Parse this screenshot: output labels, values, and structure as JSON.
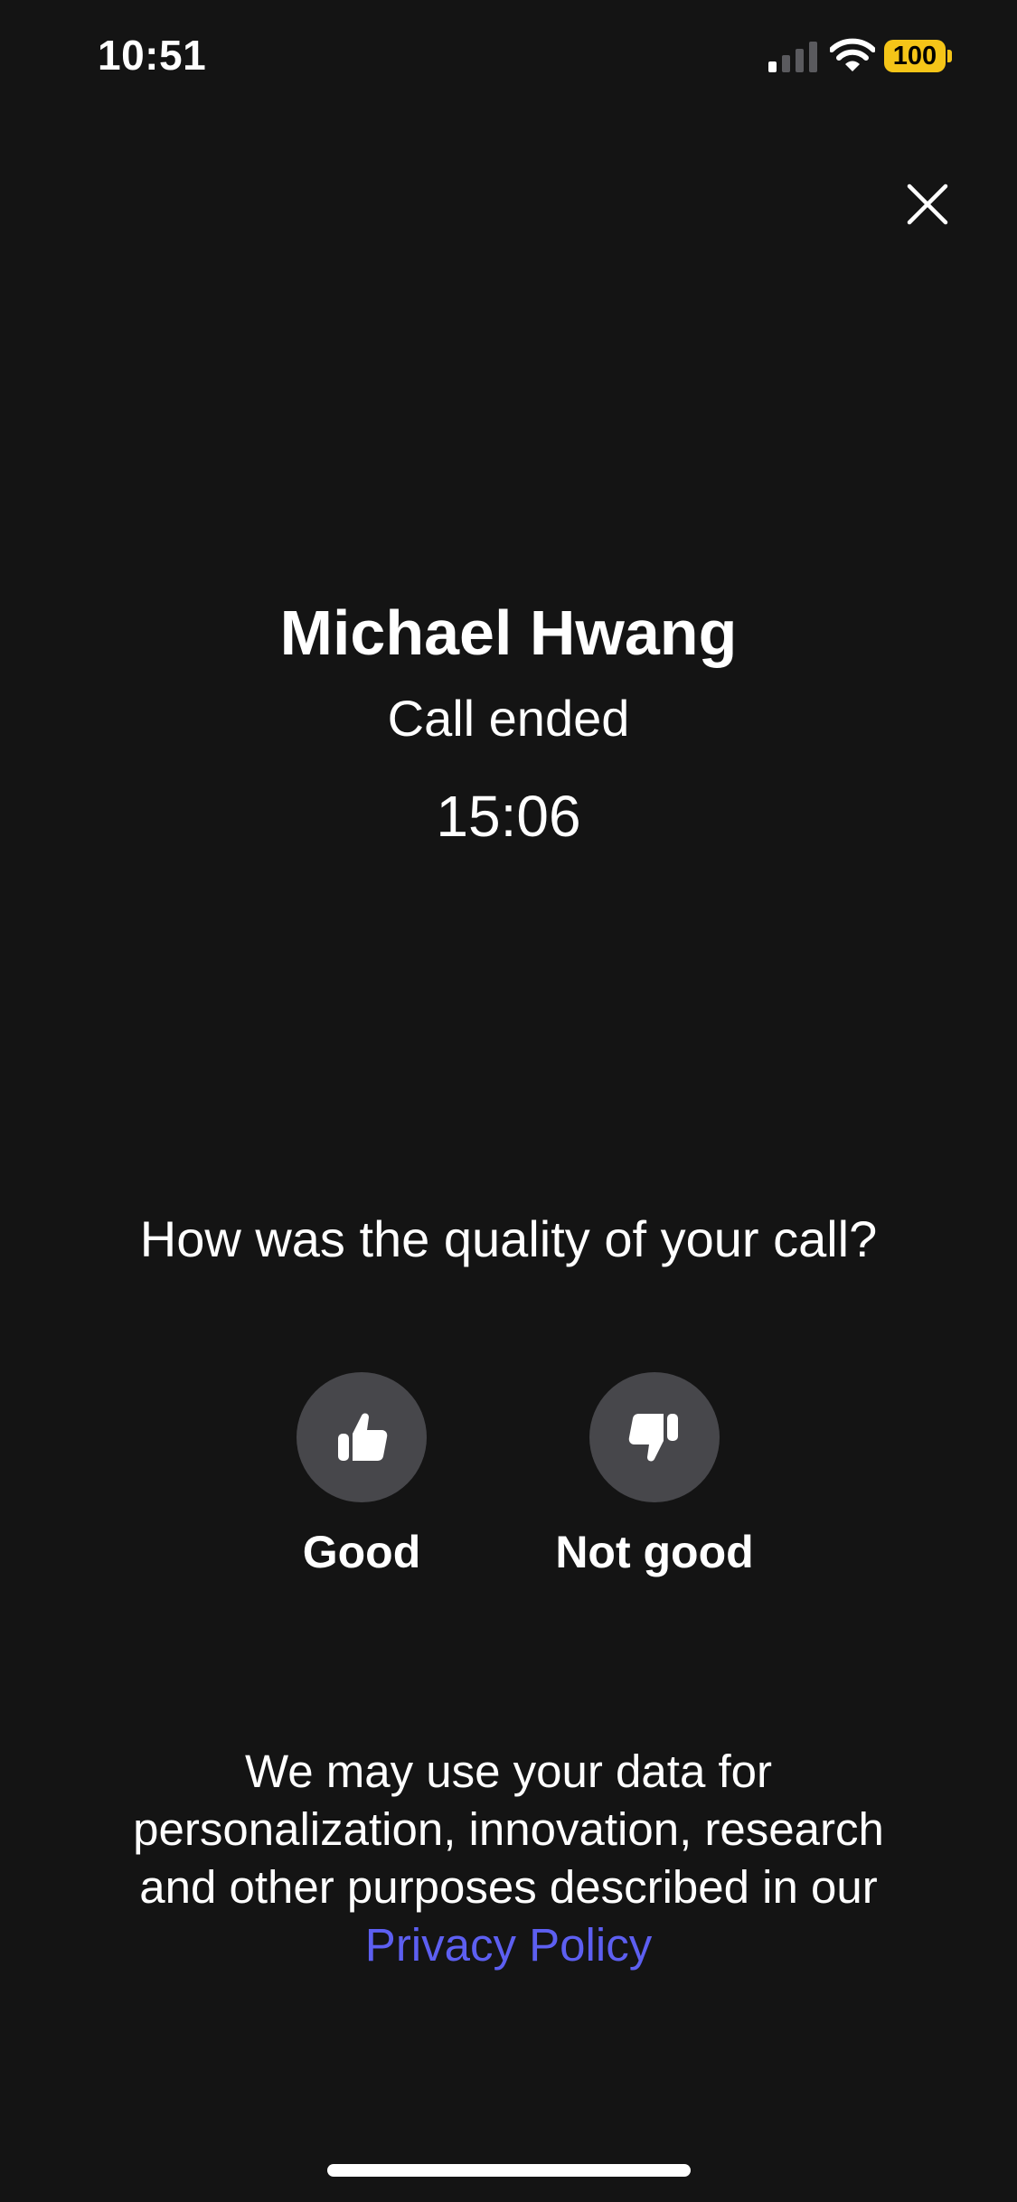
{
  "status_bar": {
    "time": "10:51",
    "battery_level": "100",
    "signal_icon": "cellular-signal-icon",
    "wifi_icon": "wifi-icon",
    "battery_color": "#f5c518"
  },
  "header": {
    "close_icon": "close-icon"
  },
  "call": {
    "caller_name": "Michael Hwang",
    "status": "Call ended",
    "duration": "15:06"
  },
  "rating": {
    "question": "How was the quality of your call?",
    "options": [
      {
        "label": "Good",
        "icon": "thumbs-up-icon"
      },
      {
        "label": "Not good",
        "icon": "thumbs-down-icon"
      }
    ],
    "button_color": "#47474b"
  },
  "privacy": {
    "text": "We may use your data for personalization, innovation, research and other purposes described in our",
    "link_label": "Privacy Policy",
    "link_color": "#5d5ff1"
  },
  "theme": {
    "background": "#141414",
    "foreground": "#ffffff"
  }
}
